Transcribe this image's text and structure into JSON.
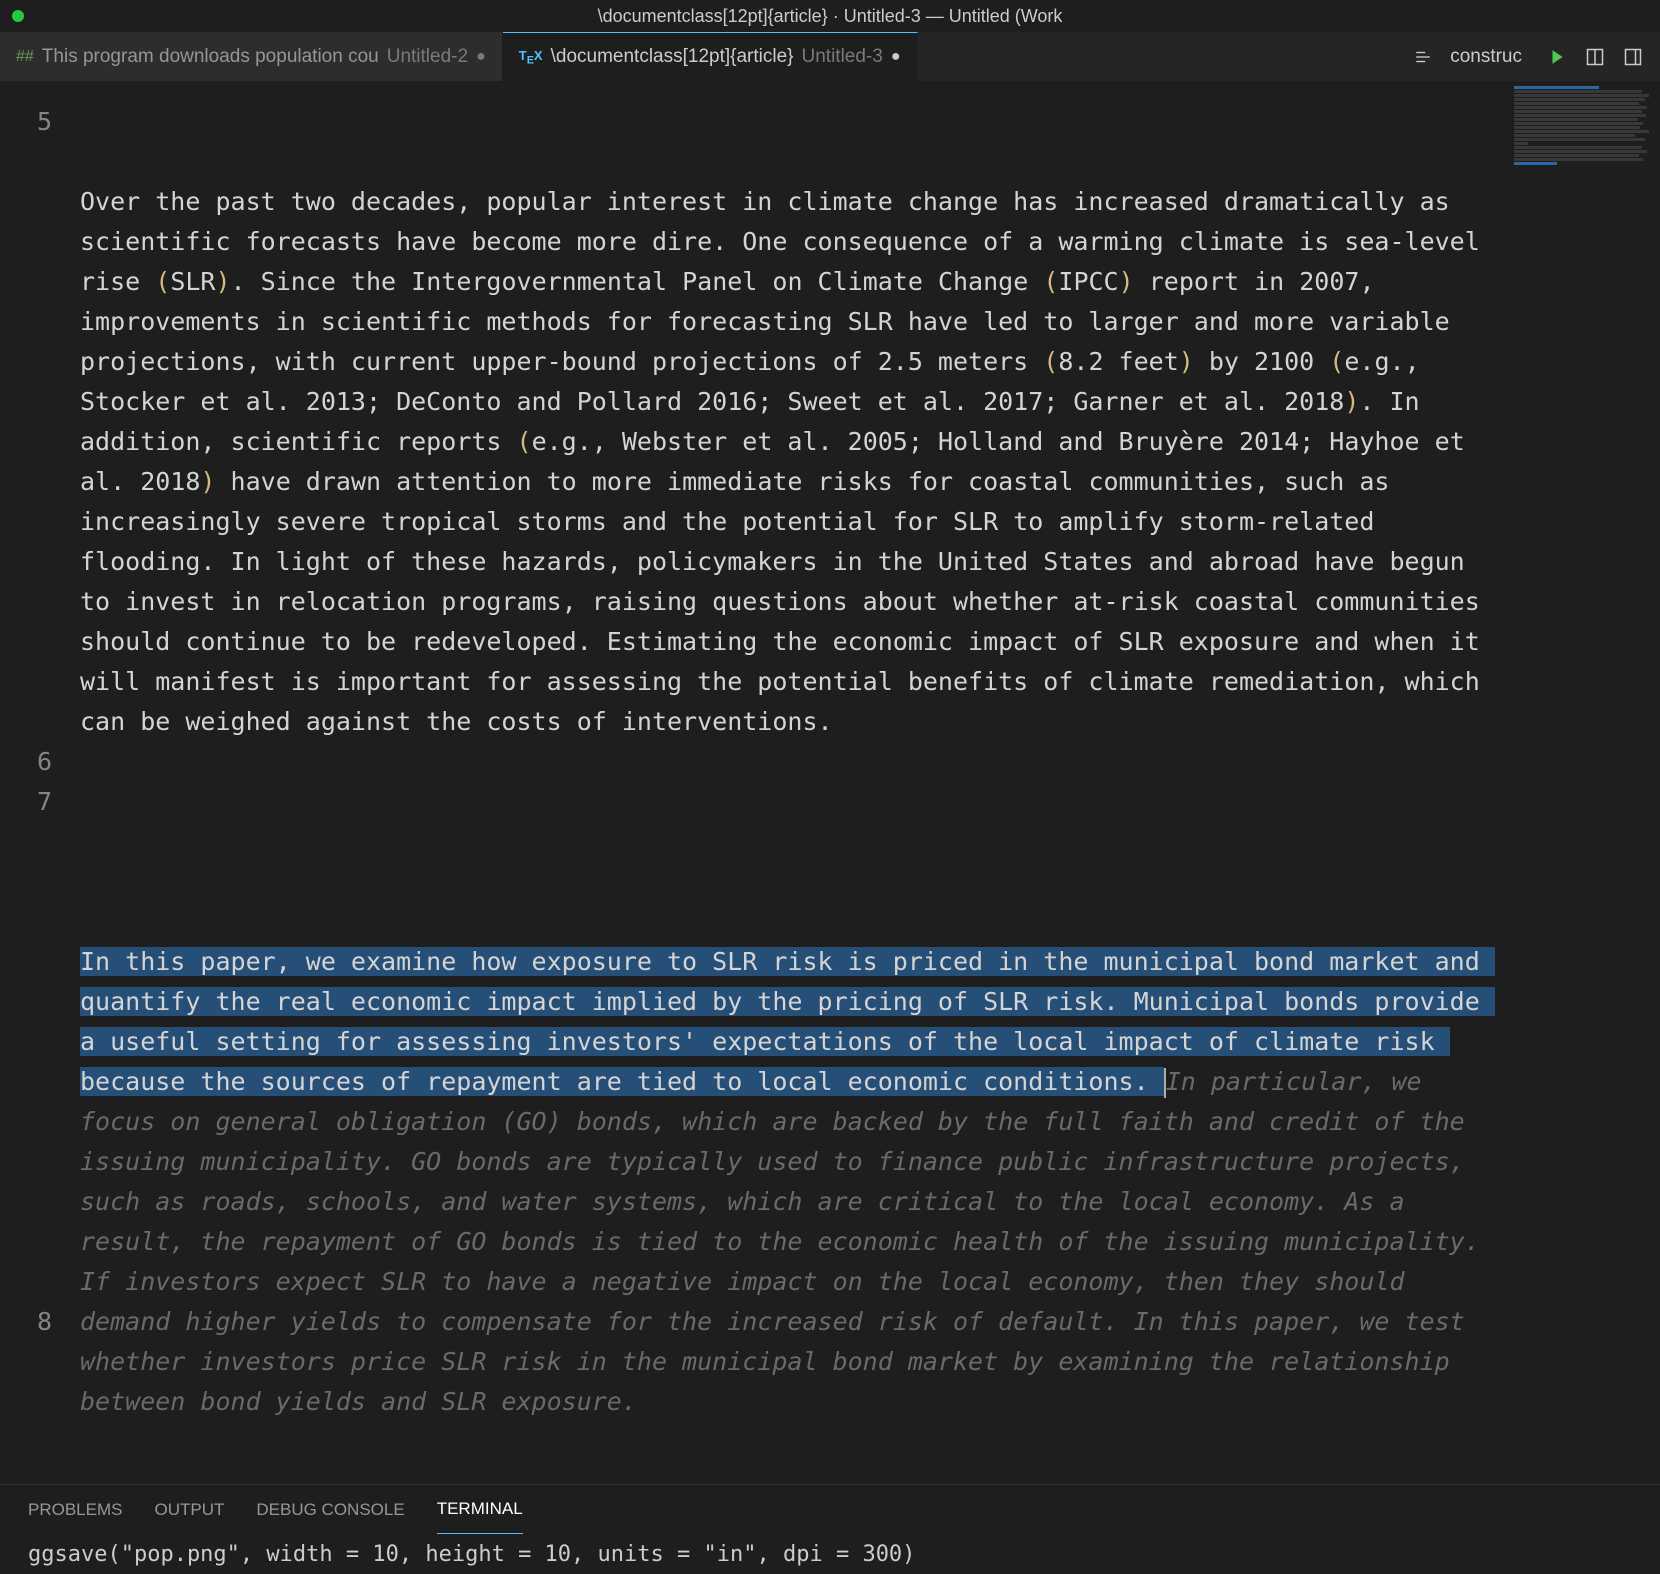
{
  "window": {
    "title": "\\documentclass[12pt]{article} · Untitled-3 — Untitled (Work"
  },
  "tabs": [
    {
      "icon": "##",
      "name": "This program downloads population cou",
      "suffix": "Untitled-2",
      "modified": true,
      "active": false
    },
    {
      "icon": "TEX",
      "name": "\\documentclass[12pt]{article}",
      "suffix": "Untitled-3",
      "modified": true,
      "active": true
    }
  ],
  "actions": {
    "construc": "construc"
  },
  "lines": {
    "l5": "5",
    "l6": "6",
    "l7": "7",
    "l8": "8"
  },
  "para1": {
    "seg1": "Over the past two decades, popular interest in climate change has increased dramatically as scientific forecasts have become more dire. One consequence of a warming climate is sea-level rise ",
    "p1": "(",
    "seg2": "SLR",
    "p2": ")",
    "seg3": ". Since the Intergovernmental Panel on Climate Change ",
    "p3": "(",
    "seg4": "IPCC",
    "p4": ")",
    "seg5": " report in 2007, improvements in scientific methods for forecasting SLR have led to larger and more variable projections, with current upper-bound projections of 2.5 meters ",
    "p5": "(",
    "seg6": "8.2 feet",
    "p6": ")",
    "seg7": " by 2100 ",
    "p7": "(",
    "seg8": "e.g., Stocker et al. 2013; DeConto and Pollard 2016; Sweet et al. 2017; Garner et al. 2018",
    "p8": ")",
    "seg9": ". In addition, scientific reports ",
    "p9": "(",
    "seg10": "e.g., Webster et al. 2005; Holland and Bruyère 2014; Hayhoe et al. 2018",
    "p10": ")",
    "seg11": " have drawn attention to more immediate risks for coastal communities, such as increasingly severe tropical storms and the potential for SLR to amplify storm-related flooding. In light of these hazards, policymakers in the United States and abroad have begun to invest in relocation programs, raising questions about whether at-risk coastal communities should continue to be redeveloped. Estimating the economic impact of SLR exposure and when it will manifest is important for assessing the potential benefits of climate remediation, which can be weighed against the costs of interventions."
  },
  "para2": {
    "normal": "In this paper, we examine how exposure to SLR risk is priced in the municipal bond market and quantify the real economic impact implied by the pricing of SLR risk. Municipal bonds provide a useful setting for assessing investors' expectations of the local impact of climate risk because the sources of repayment are tied to local economic conditions. ",
    "suggestion": "In particular, we focus on general obligation (GO) bonds, which are backed by the full faith and credit of the issuing municipality. GO bonds are typically used to finance public infrastructure projects, such as roads, schools, and water systems, which are critical to the local economy. As a result, the repayment of GO bonds is tied to the economic health of the issuing municipality. If investors expect SLR to have a negative impact on the local economy, then they should demand higher yields to compensate for the increased risk of default. In this paper, we test whether investors price SLR risk in the municipal bond market by examining the relationship between bond yields and SLR exposure."
  },
  "panel": {
    "problems": "PROBLEMS",
    "output": "OUTPUT",
    "debug": "DEBUG CONSOLE",
    "terminal": "TERMINAL"
  },
  "terminal": {
    "line": "ggsave(\"pop.png\", width = 10, height = 10, units = \"in\", dpi = 300)"
  }
}
